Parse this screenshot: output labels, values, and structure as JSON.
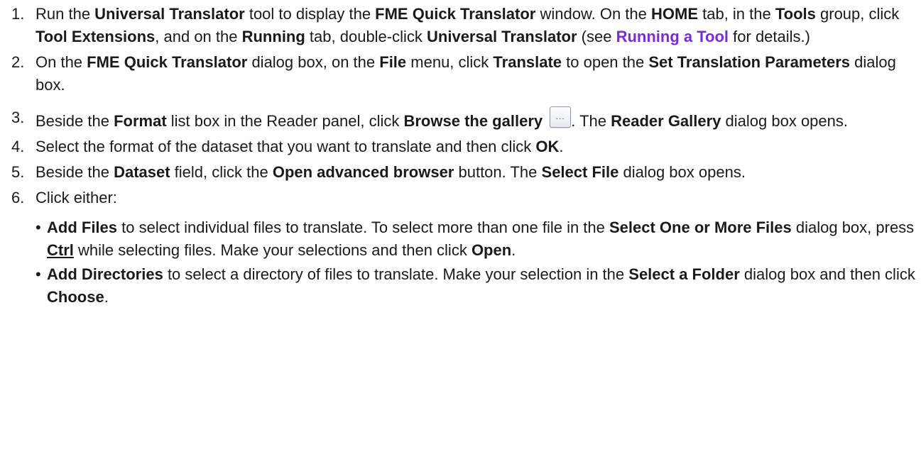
{
  "steps": [
    {
      "number": "1.",
      "parts": [
        {
          "t": "Run the "
        },
        {
          "t": "Universal Translator",
          "b": true
        },
        {
          "t": " tool to display the "
        },
        {
          "t": "FME Quick Translator",
          "b": true
        },
        {
          "t": " window. On the "
        },
        {
          "t": "HOME",
          "b": true
        },
        {
          "t": " tab, in the "
        },
        {
          "t": "Tools",
          "b": true
        },
        {
          "t": " group, click "
        },
        {
          "t": "Tool Extensions",
          "b": true
        },
        {
          "t": ", and on the "
        },
        {
          "t": "Running",
          "b": true
        },
        {
          "t": " tab, double-click "
        },
        {
          "t": "Universal Translator",
          "b": true
        },
        {
          "t": " (see "
        },
        {
          "t": "Running a Tool",
          "link": true
        },
        {
          "t": " for details.)"
        }
      ]
    },
    {
      "number": "2.",
      "parts": [
        {
          "t": "On the "
        },
        {
          "t": "FME Quick Translator",
          "b": true
        },
        {
          "t": " dialog box, on the "
        },
        {
          "t": "File",
          "b": true
        },
        {
          "t": " menu, click "
        },
        {
          "t": "Translate",
          "b": true
        },
        {
          "t": " to open the "
        },
        {
          "t": "Set Translation Parameters",
          "b": true
        },
        {
          "t": " dialog box."
        }
      ]
    },
    {
      "number": "3.",
      "parts": [
        {
          "t": "Beside the "
        },
        {
          "t": "Format",
          "b": true
        },
        {
          "t": " list box in the Reader panel, click "
        },
        {
          "t": "Browse the gallery",
          "b": true
        },
        {
          "t": " "
        },
        {
          "button": true,
          "label": "..."
        },
        {
          "t": ". The "
        },
        {
          "t": "Reader Gallery",
          "b": true
        },
        {
          "t": " dialog box opens."
        }
      ]
    },
    {
      "number": "4.",
      "parts": [
        {
          "t": "Select the format of the dataset that you want to translate and then click "
        },
        {
          "t": "OK",
          "b": true
        },
        {
          "t": "."
        }
      ]
    },
    {
      "number": "5.",
      "parts": [
        {
          "t": "Beside the "
        },
        {
          "t": "Dataset",
          "b": true
        },
        {
          "t": " field, click the "
        },
        {
          "t": "Open advanced browser",
          "b": true
        },
        {
          "t": " button. The "
        },
        {
          "t": "Select File",
          "b": true
        },
        {
          "t": " dialog box opens."
        }
      ]
    },
    {
      "number": "6.",
      "parts": [
        {
          "t": "Click either:"
        }
      ],
      "sub": [
        {
          "bullet": "•",
          "parts": [
            {
              "t": "Add Files",
              "b": true
            },
            {
              "t": " to select individual files to translate. To select more than one file in the "
            },
            {
              "t": "Select One or More Files",
              "b": true
            },
            {
              "t": " dialog box, press "
            },
            {
              "t": "Ctrl",
              "kbd": true
            },
            {
              "t": " while selecting files. Make your selections and then click "
            },
            {
              "t": "Open",
              "b": true
            },
            {
              "t": "."
            }
          ]
        },
        {
          "bullet": "•",
          "parts": [
            {
              "t": "Add Directories",
              "b": true
            },
            {
              "t": " to select a directory of files to translate. Make your selection in the "
            },
            {
              "t": "Select a Folder",
              "b": true
            },
            {
              "t": " dialog box and then click "
            },
            {
              "t": "Choose",
              "b": true
            },
            {
              "t": "."
            }
          ]
        }
      ]
    }
  ],
  "colors": {
    "text": "#1a1a1a",
    "link": "#7a2bd9"
  }
}
